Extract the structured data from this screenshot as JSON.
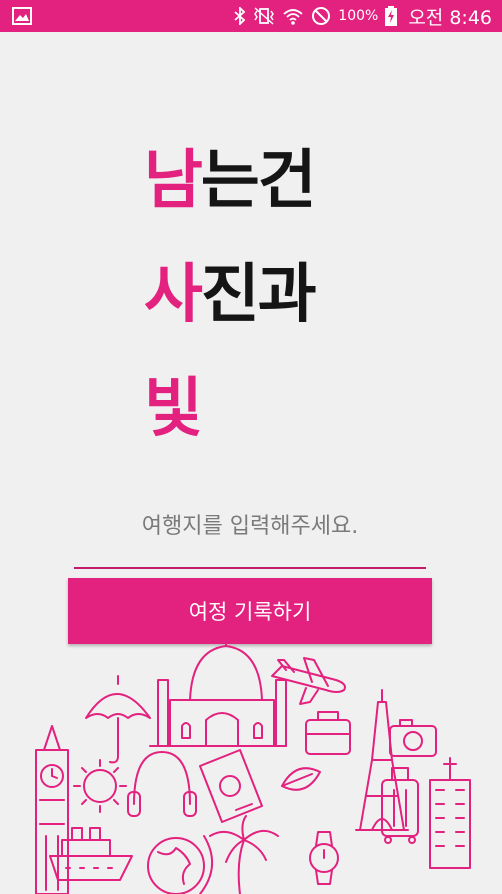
{
  "colors": {
    "accent": "#e3217f",
    "background": "#f0f0f0",
    "title_dark": "#151515"
  },
  "status_bar": {
    "battery": "100%",
    "time": "오전 8:46",
    "icons": [
      "gallery-notification-icon",
      "bluetooth-icon",
      "vibrate-icon",
      "wifi-icon",
      "do-not-disturb-icon",
      "battery-charging-icon"
    ]
  },
  "title": {
    "rows": [
      {
        "accent": "남",
        "rest": "는건"
      },
      {
        "accent": "사",
        "rest": "진과"
      },
      {
        "accent": "빛",
        "rest": ""
      }
    ]
  },
  "destination_input": {
    "value": "",
    "placeholder": "여행지를 입력해주세요."
  },
  "record_button": {
    "label": "여정 기록하기"
  },
  "illustration": {
    "icons": [
      "umbrella-icon",
      "taj-mahal-icon",
      "airplane-icon",
      "big-ben-icon",
      "sun-icon",
      "headphones-icon",
      "passport-icon",
      "briefcase-icon",
      "eiffel-tower-icon",
      "camera-icon",
      "suitcase-icon",
      "building-icon",
      "ship-icon",
      "globe-icon",
      "palm-tree-icon",
      "leaf-icon"
    ]
  }
}
